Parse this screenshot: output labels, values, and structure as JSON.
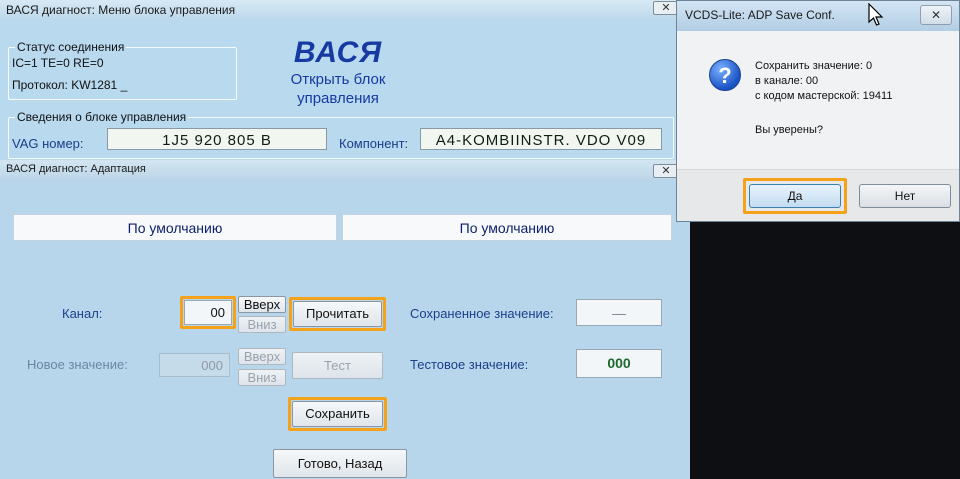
{
  "main": {
    "title": "ВАСЯ диагност: Меню блока управления",
    "close_glyph": "✕",
    "connection": {
      "title": "Статус соединения",
      "line1": "IC=1  TE=0   RE=0",
      "protocol": "Протокол: KW1281   _"
    },
    "brand": {
      "name": "ВАСЯ",
      "subtitle1": "Открыть блок",
      "subtitle2": "управления"
    },
    "module": {
      "title": "Сведения о блоке управления",
      "vag_label": "VAG номер:",
      "vag_value": "1J5 920 805 B",
      "component_label": "Компонент:",
      "component_value": "A4-KOMBIINSTR. VDO V09"
    }
  },
  "adapt": {
    "title": "ВАСЯ диагност: Адаптация",
    "close_glyph": "✕",
    "default_left": "По умолчанию",
    "default_right": "По умолчанию",
    "channel_label": "Канал:",
    "channel_value": "00",
    "up_label": "Вверх",
    "down_label": "Вниз",
    "read_button": "Прочитать",
    "saved_label": "Сохраненное значение:",
    "saved_value": "—",
    "new_value_label": "Новое значение:",
    "new_value": "000",
    "up2_label": "Вверх",
    "down2_label": "Вниз",
    "test_button": "Тест",
    "test_value_label": "Тестовое значение:",
    "test_value": "000",
    "save_button": "Сохранить",
    "done_button": "Готово, Назад"
  },
  "dialog": {
    "title": "VCDS-Lite: ADP Save Conf.",
    "close_glyph": "✕",
    "icon": "question-icon",
    "icon_glyph": "?",
    "line1": "Сохранить значение: 0",
    "line2": "в канале: 00",
    "line3": "с кодом мастерской: 19411",
    "question": "Вы уверены?",
    "yes": "Да",
    "no": "Нет"
  },
  "colors": {
    "highlight": "#f4a21a",
    "brand": "#163aa2",
    "label": "#1c3d8a"
  }
}
